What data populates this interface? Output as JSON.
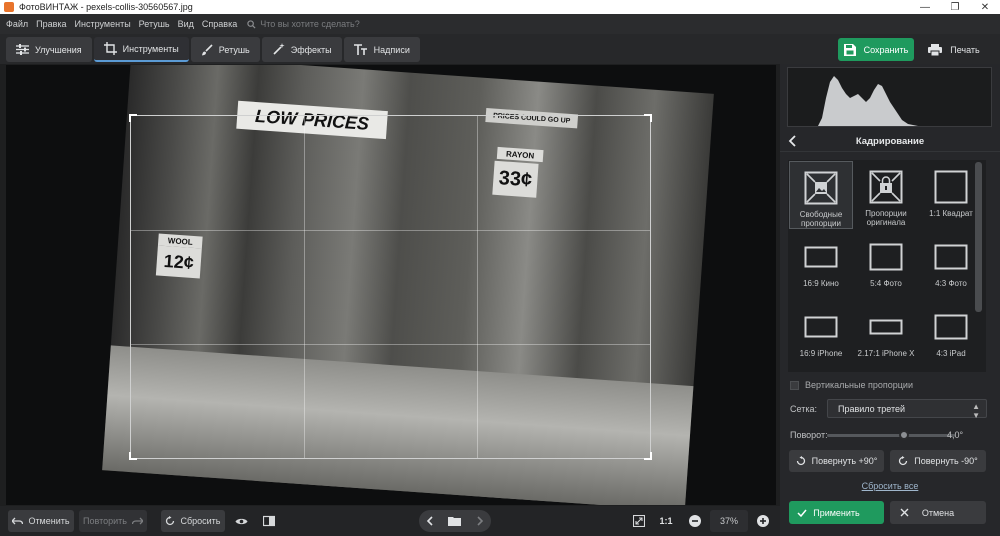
{
  "window": {
    "title": "ФотоВИНТАЖ - pexels-collis-30560567.jpg",
    "controls": [
      "—",
      "❐",
      "✕"
    ]
  },
  "menu": {
    "items": [
      "Файл",
      "Правка",
      "Инструменты",
      "Ретушь",
      "Вид",
      "Справка"
    ],
    "search_placeholder": "Что вы хотите сделать?"
  },
  "tabs": [
    {
      "label": "Улучшения",
      "icon": "sliders-icon"
    },
    {
      "label": "Инструменты",
      "icon": "crop-icon",
      "active": true
    },
    {
      "label": "Ретушь",
      "icon": "brush-icon"
    },
    {
      "label": "Эффекты",
      "icon": "magic-wand-icon"
    },
    {
      "label": "Надписи",
      "icon": "text-icon"
    }
  ],
  "actions": {
    "save": "Сохранить",
    "print": "Печать"
  },
  "photo_signs": {
    "low_prices": "LOW PRICES",
    "price_12": "12¢",
    "price_33": "33¢",
    "wool": "WOOL",
    "rayon": "RAYON",
    "prices_could": "PRICES COULD GO UP"
  },
  "bottom": {
    "undo": "Отменить",
    "redo": "Повторить",
    "reset": "Сбросить",
    "ratio": "1:1",
    "zoom": "37%"
  },
  "panel": {
    "title": "Кадрирование",
    "presets": [
      {
        "label": "Свободные пропорции",
        "icon": "free-ratio-icon",
        "selected": true
      },
      {
        "label": "Пропорции оригинала",
        "icon": "original-ratio-icon"
      },
      {
        "label": "1:1 Квадрат",
        "icon": "square-icon"
      },
      {
        "label": "16:9 Кино",
        "icon": "ratio-16-9-icon"
      },
      {
        "label": "5:4 Фото",
        "icon": "ratio-5-4-icon"
      },
      {
        "label": "4:3 Фото",
        "icon": "ratio-4-3-icon"
      },
      {
        "label": "16:9 iPhone",
        "icon": "iphone-icon"
      },
      {
        "label": "2.17:1 iPhone X",
        "icon": "iphone-x-icon"
      },
      {
        "label": "4:3 iPad",
        "icon": "ipad-icon"
      }
    ],
    "vertical_label": "Вертикальные пропорции",
    "grid_label": "Сетка:",
    "grid_value": "Правило третей",
    "rotation_label": "Поворот:",
    "rotation_value": "4,0°",
    "rotation_fraction": 0.6,
    "rotate_plus": "Повернуть +90°",
    "rotate_minus": "Повернуть -90°",
    "reset_all": "Сбросить все",
    "apply": "Применить",
    "cancel": "Отмена"
  },
  "colors": {
    "accent": "#1f9a5e",
    "panel": "#26272a",
    "tab_active": "#5b9bd5"
  }
}
